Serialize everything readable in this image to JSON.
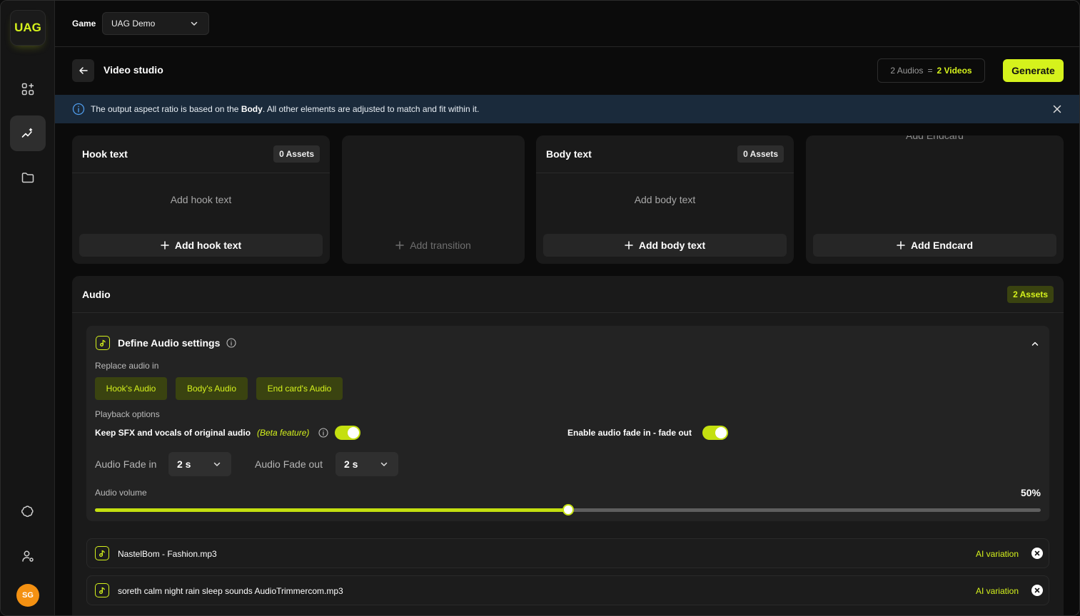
{
  "app": {
    "logo_text": "UAG",
    "user_initials": "SG"
  },
  "sidebar": {
    "items": [
      {
        "icon": "apps-icon",
        "active": false
      },
      {
        "icon": "analytics-sparkle-icon",
        "active": true
      },
      {
        "icon": "folder-icon",
        "active": false
      },
      {
        "icon": "brain-icon",
        "active": false
      },
      {
        "icon": "user-settings-icon",
        "active": false
      }
    ]
  },
  "topbar": {
    "game_label": "Game",
    "game_value": "UAG Demo"
  },
  "header": {
    "title": "Video studio",
    "audios_count": "2 Audios",
    "equals": "=",
    "videos_count": "2 Videos",
    "generate_label": "Generate"
  },
  "banner": {
    "msg_before": "The output aspect ratio is based on the ",
    "msg_bold": "Body",
    "msg_after": ". All other elements are adjusted to match and fit within it."
  },
  "cards": {
    "hook": {
      "title": "Hook text",
      "badge": "0 Assets",
      "placeholder": "Add hook text",
      "add_label": "Add hook text"
    },
    "transition": {
      "add_label": "Add transition"
    },
    "body": {
      "title": "Body text",
      "badge": "0 Assets",
      "placeholder": "Add body text",
      "add_label": "Add body text"
    },
    "endcard": {
      "title": "Add Endcard",
      "add_label": "Add Endcard"
    }
  },
  "audio": {
    "title": "Audio",
    "badge": "2 Assets",
    "settings": {
      "title": "Define Audio settings",
      "replace_label": "Replace audio in",
      "replace_options": [
        "Hook's Audio",
        "Body's Audio",
        "End card's Audio"
      ],
      "playback_label": "Playback options",
      "keep_sfx_label": "Keep SFX and vocals of original audio",
      "beta_label": "(Beta feature)",
      "keep_sfx_on": true,
      "fade_label": "Enable audio fade in - fade out",
      "fade_on": true,
      "fade_in_label": "Audio Fade in",
      "fade_in_value": "2 s",
      "fade_out_label": "Audio Fade out",
      "fade_out_value": "2 s",
      "volume_label": "Audio volume",
      "volume_text": "50%",
      "volume_fraction": 0.5
    },
    "files": [
      {
        "name": "NastelBom - Fashion.mp3",
        "tag": "AI variation"
      },
      {
        "name": "soreth calm night rain sleep sounds AudioTrimmercom.mp3",
        "tag": "AI variation"
      }
    ]
  },
  "colors": {
    "accent": "#d5f21c",
    "avatar": "#f49112",
    "banner_bg": "#1a2a3b"
  }
}
